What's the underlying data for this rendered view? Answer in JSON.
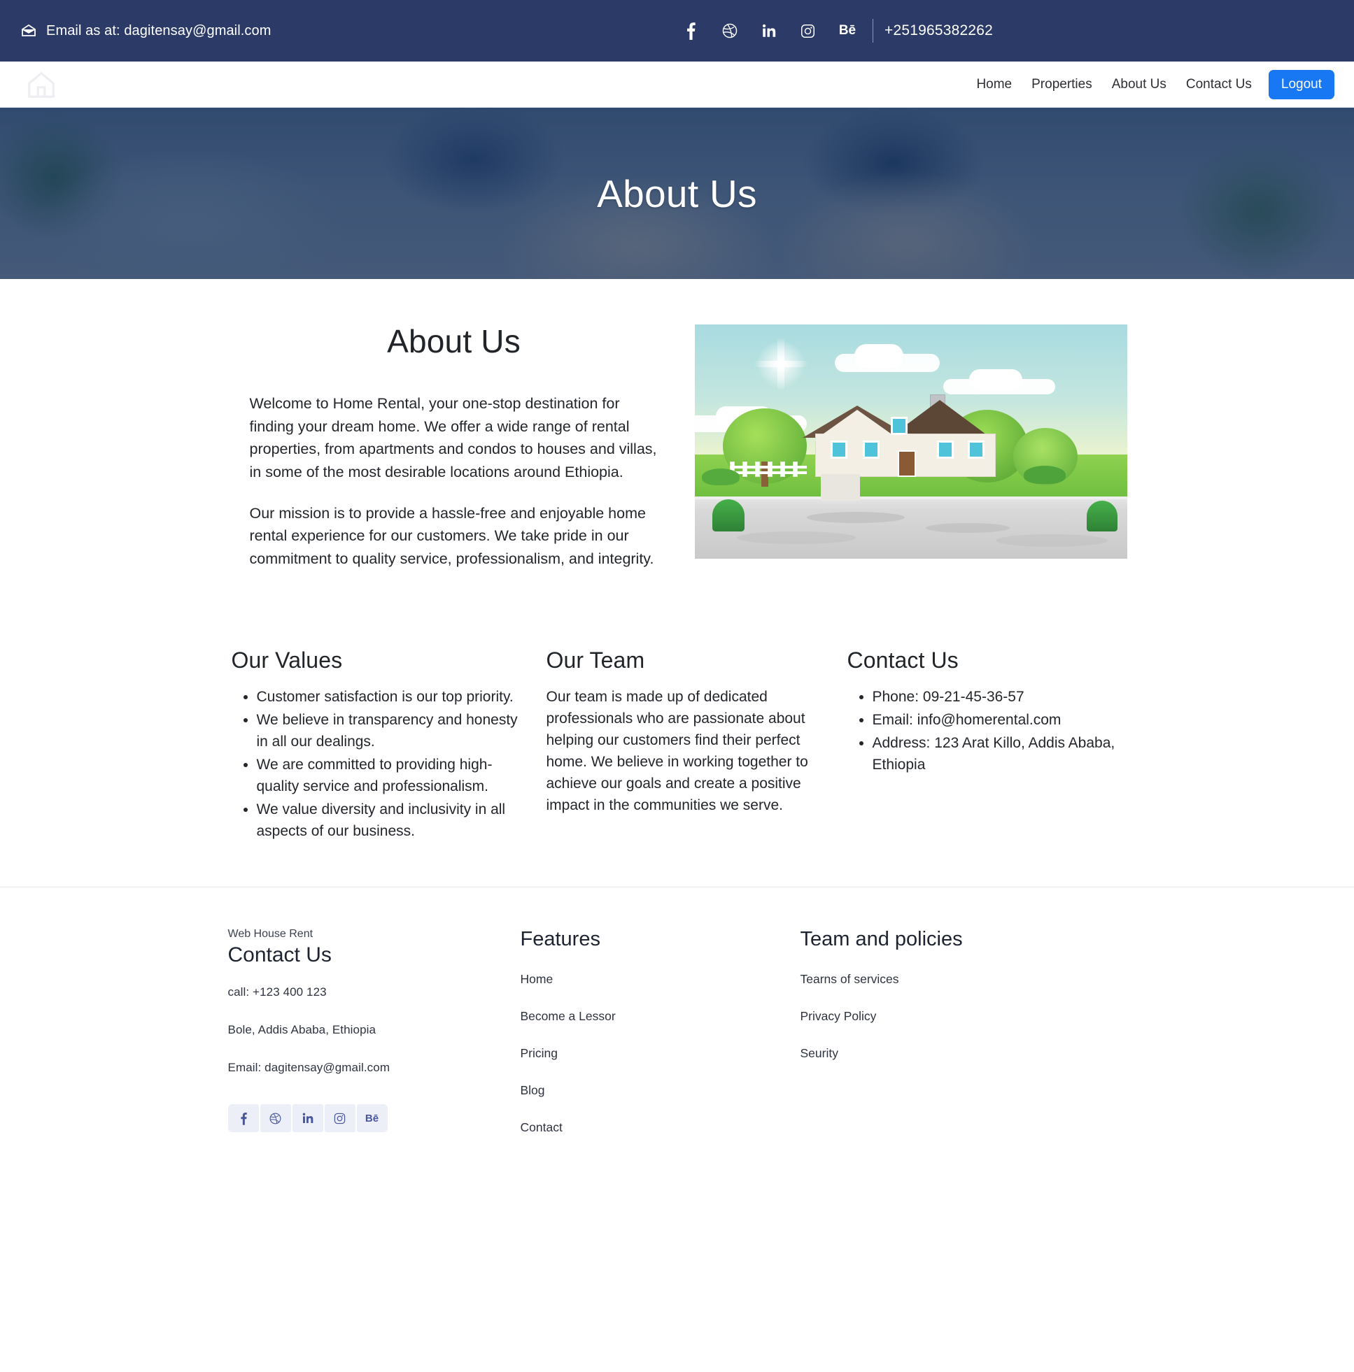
{
  "topbar": {
    "email_icon": "envelope-icon",
    "email_text": "Email as at: dagitensay@gmail.com",
    "socials": [
      {
        "name": "facebook-icon",
        "label": "f"
      },
      {
        "name": "dribbble-icon",
        "label": "dribbble"
      },
      {
        "name": "linkedin-icon",
        "label": "in"
      },
      {
        "name": "instagram-icon",
        "label": "instagram"
      },
      {
        "name": "behance-icon",
        "label": "Bē"
      }
    ],
    "phone": "+251965382262",
    "background_color": "#2b3a67"
  },
  "navbar": {
    "logo_icon": "house-logo-icon",
    "links": [
      {
        "label": "Home"
      },
      {
        "label": "Properties"
      },
      {
        "label": "About Us"
      },
      {
        "label": "Contact Us"
      }
    ],
    "logout_label": "Logout",
    "logout_color": "#1877f2"
  },
  "hero": {
    "title": "About Us"
  },
  "about": {
    "heading": "About Us",
    "paragraph1": "Welcome to Home Rental, your one-stop destination for finding your dream home. We offer a wide range of rental properties, from apartments and condos to houses and villas, in some of the most desirable locations around Ethiopia.",
    "paragraph2": "Our mission is to provide a hassle-free and enjoyable home rental experience for our customers. We take pride in our commitment to quality service, professionalism, and integrity.",
    "image_name": "house-illustration"
  },
  "columns": {
    "values": {
      "heading": "Our Values",
      "items": [
        "Customer satisfaction is our top priority.",
        "We believe in transparency and honesty in all our dealings.",
        "We are committed to providing high-quality service and professionalism.",
        "We value diversity and inclusivity in all aspects of our business."
      ]
    },
    "team": {
      "heading": "Our Team",
      "text": "Our team is made up of dedicated professionals who are passionate about helping our customers find their perfect home. We believe in working together to achieve our goals and create a positive impact in the communities we serve."
    },
    "contact": {
      "heading": "Contact Us",
      "items": [
        "Phone: 09-21-45-36-57",
        "Email: info@homerental.com",
        "Address: 123 Arat Killo, Addis Ababa, Ethiopia"
      ]
    }
  },
  "footer": {
    "brand": {
      "small_label": "Web House Rent",
      "title": "Contact Us",
      "phone": "call: +123 400 123",
      "address": "Bole, Addis Ababa, Ethiopia",
      "email": "Email: dagitensay@gmail.com",
      "socials": [
        {
          "name": "facebook-icon"
        },
        {
          "name": "dribbble-icon"
        },
        {
          "name": "linkedin-icon"
        },
        {
          "name": "instagram-icon"
        },
        {
          "name": "behance-icon"
        }
      ]
    },
    "features": {
      "heading": "Features",
      "links": [
        "Home",
        "Become a Lessor",
        "Pricing",
        "Blog",
        "Contact"
      ]
    },
    "policies": {
      "heading": "Team and policies",
      "links": [
        "Tearns of services",
        "Privacy Policy",
        "Seurity"
      ]
    }
  }
}
